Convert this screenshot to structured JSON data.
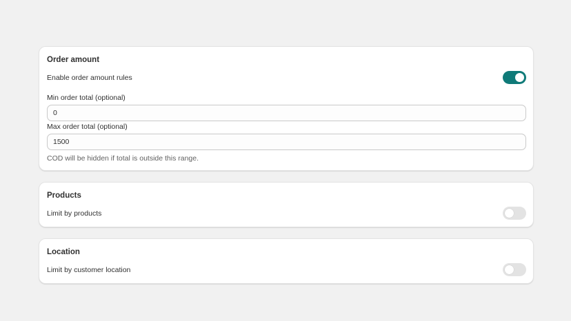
{
  "order_amount": {
    "title": "Order amount",
    "enable_label": "Enable order amount rules",
    "enable_toggle": true,
    "min": {
      "label": "Min order total (optional)",
      "value": "0"
    },
    "max": {
      "label": "Max order total (optional)",
      "value": "1500"
    },
    "help_text": "COD will be hidden if total is outside this range."
  },
  "products": {
    "title": "Products",
    "limit_label": "Limit by products",
    "limit_toggle": false
  },
  "location": {
    "title": "Location",
    "limit_label": "Limit by customer location",
    "limit_toggle": false
  },
  "colors": {
    "toggle_on": "#0f7a78",
    "toggle_off": "#e3e3e3",
    "page_background": "#f1f1f1"
  }
}
